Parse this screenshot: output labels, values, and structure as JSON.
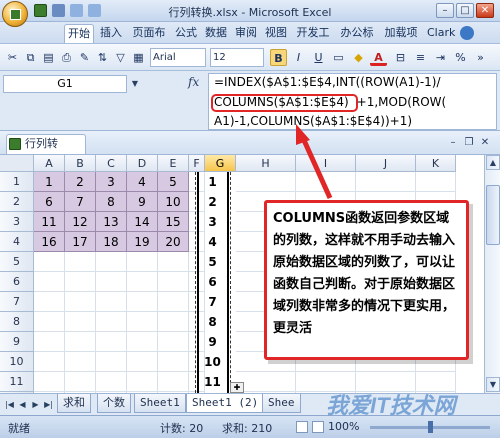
{
  "app": {
    "title": "行列转换.xlsx - Microsoft Excel",
    "window_controls": {
      "minimize": "–",
      "maximize": "□",
      "close": "✕"
    }
  },
  "ribbon": {
    "tabs": [
      {
        "label": "开始"
      },
      {
        "label": "插入"
      },
      {
        "label": "页面布"
      },
      {
        "label": "公式"
      },
      {
        "label": "数据"
      },
      {
        "label": "审阅"
      },
      {
        "label": "视图"
      },
      {
        "label": "开发工"
      },
      {
        "label": "办公标"
      },
      {
        "label": "加载项"
      },
      {
        "label": "Clark"
      }
    ]
  },
  "toolbar": {
    "font_name": "Arial",
    "font_size": "12",
    "bold_label": "B",
    "italic_label": "I",
    "underline_label": "U",
    "font_color_label": "A"
  },
  "formula_bar": {
    "name_box": "G1",
    "fx_label": "fx",
    "line1": "=INDEX($A$1:$E$4,INT((ROW(A1)-1)/",
    "line2_highlight": "COLUMNS($A$1:$E$4)",
    "line2_rest": "+1,MOD(ROW(",
    "line3": "A1)-1,COLUMNS($A$1:$E$4))+1)"
  },
  "workbook": {
    "tab_label": "行列转换.xlsx *"
  },
  "grid": {
    "columns": [
      "A",
      "B",
      "C",
      "D",
      "E",
      "F",
      "G",
      "H",
      "I",
      "J",
      "K"
    ],
    "rows": [
      "1",
      "2",
      "3",
      "4",
      "5",
      "6",
      "7",
      "8",
      "9",
      "10",
      "11",
      "12"
    ],
    "matrix": [
      [
        "1",
        "2",
        "3",
        "4",
        "5"
      ],
      [
        "6",
        "7",
        "8",
        "9",
        "10"
      ],
      [
        "11",
        "12",
        "13",
        "14",
        "15"
      ],
      [
        "16",
        "17",
        "18",
        "19",
        "20"
      ]
    ],
    "column_g": [
      "1",
      "2",
      "3",
      "4",
      "5",
      "6",
      "7",
      "8",
      "9",
      "10",
      "11",
      "12"
    ]
  },
  "callout": {
    "text": "COLUMNS函数返回参数区域的列数，这样就不用手动去输入原始数据区域的列数了，可以让函数自己判断。对于原始数据区域列数非常多的情况下更实用，更灵活"
  },
  "sheet_tabs": {
    "tabs": [
      {
        "label": "求和",
        "zh": true
      },
      {
        "label": "个数",
        "zh": true
      },
      {
        "label": "Sheet1",
        "zh": false
      },
      {
        "label": "Sheet1 (2)",
        "zh": false,
        "active": true
      },
      {
        "label": "Shee",
        "zh": false
      }
    ]
  },
  "status_bar": {
    "ready": "就绪",
    "count": "计数: 20",
    "sum": "求和: 210",
    "zoom": "100%"
  },
  "watermark": {
    "text": "我爱IT技术网"
  },
  "colors": {
    "accent_red": "#e02626",
    "cell_purple": "#d7c9e2"
  }
}
